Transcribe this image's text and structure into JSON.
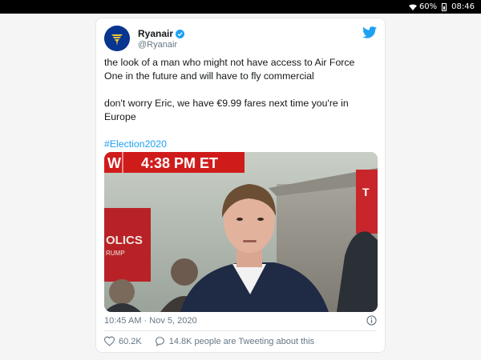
{
  "status_bar": {
    "battery": "60%",
    "time": "08:46"
  },
  "tweet": {
    "display_name": "Ryanair",
    "handle": "@Ryanair",
    "text_lines": [
      "the look of a man who might not have access to Air Force",
      "One in the future and will have to fly commercial",
      "",
      "don't worry Eric, we have €9.99 fares next time you're in",
      "Europe",
      ""
    ],
    "hashtag": "#Election2020",
    "timestamp": "10:45 AM · Nov 5, 2020",
    "likes": "60.2K",
    "tweeting_about": "14.8K people are Tweeting about this"
  },
  "media": {
    "banner_letter": "W",
    "banner_time": "4:38 PM ET",
    "sign_left_text": "OLICS",
    "sign_left_sub": "RUMP",
    "sign_right_text": "T"
  },
  "colors": {
    "accent": "#1da1f2",
    "brand": "#073590",
    "banner_red": "#d01b1b"
  }
}
